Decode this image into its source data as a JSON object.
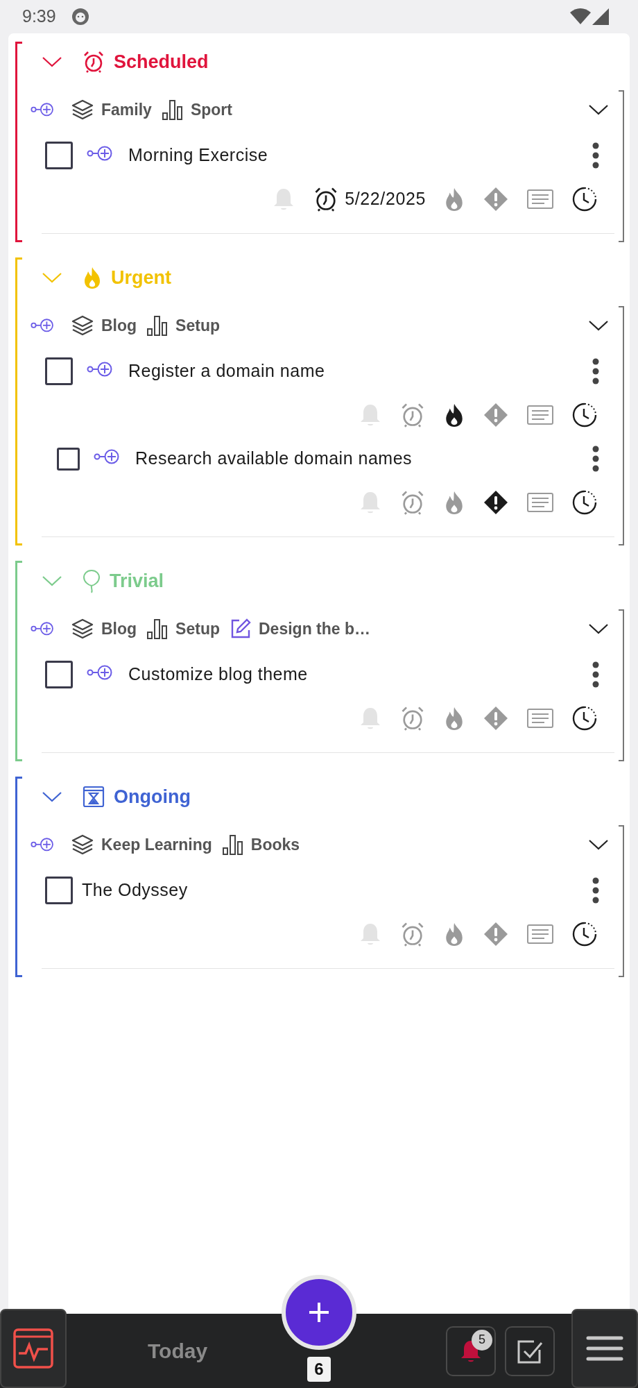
{
  "status_bar": {
    "time": "9:39"
  },
  "sections": [
    {
      "title": "Scheduled",
      "kind": "scheduled",
      "color": "#e0143c",
      "expanded": true,
      "group": {
        "expanded": true,
        "tags": [
          {
            "kind": "area",
            "label": "Family"
          },
          {
            "kind": "project",
            "label": "Sport"
          }
        ],
        "tasks": [
          {
            "title": "Morning Exercise",
            "checked": false,
            "linked": true,
            "reminder": false,
            "scheduled": true,
            "date": "5/22/2025",
            "urgent": false,
            "important": false
          }
        ]
      }
    },
    {
      "title": "Urgent",
      "kind": "urgent",
      "color": "#f2c200",
      "expanded": true,
      "group": {
        "expanded": true,
        "tags": [
          {
            "kind": "area",
            "label": "Blog"
          },
          {
            "kind": "project",
            "label": "Setup"
          }
        ],
        "tasks": [
          {
            "title": "Register a domain name",
            "checked": false,
            "linked": true,
            "reminder": false,
            "scheduled": false,
            "urgent": true,
            "important": false,
            "children": [
              {
                "title": "Research available domain names",
                "checked": false,
                "linked": true,
                "reminder": false,
                "scheduled": false,
                "urgent": false,
                "important": true
              }
            ]
          }
        ]
      }
    },
    {
      "title": "Trivial",
      "kind": "trivial",
      "color": "#7ccb8c",
      "expanded": true,
      "group": {
        "expanded": true,
        "tags": [
          {
            "kind": "area",
            "label": "Blog"
          },
          {
            "kind": "project",
            "label": "Setup"
          },
          {
            "kind": "task",
            "label": "Design the b…"
          }
        ],
        "tasks": [
          {
            "title": "Customize blog theme",
            "checked": false,
            "linked": true,
            "reminder": false,
            "scheduled": false,
            "urgent": false,
            "important": false
          }
        ]
      }
    },
    {
      "title": "Ongoing",
      "kind": "ongoing",
      "color": "#3f63d3",
      "expanded": true,
      "group": {
        "expanded": true,
        "tags": [
          {
            "kind": "area",
            "label": "Keep Learning"
          },
          {
            "kind": "project",
            "label": "Books"
          }
        ],
        "tasks": [
          {
            "title": "The Odyssey",
            "checked": false,
            "linked": false,
            "reminder": false,
            "scheduled": false,
            "urgent": false,
            "important": false
          }
        ]
      }
    }
  ],
  "bottom_bar": {
    "title": "Today",
    "count": "6",
    "notifications": "5"
  }
}
